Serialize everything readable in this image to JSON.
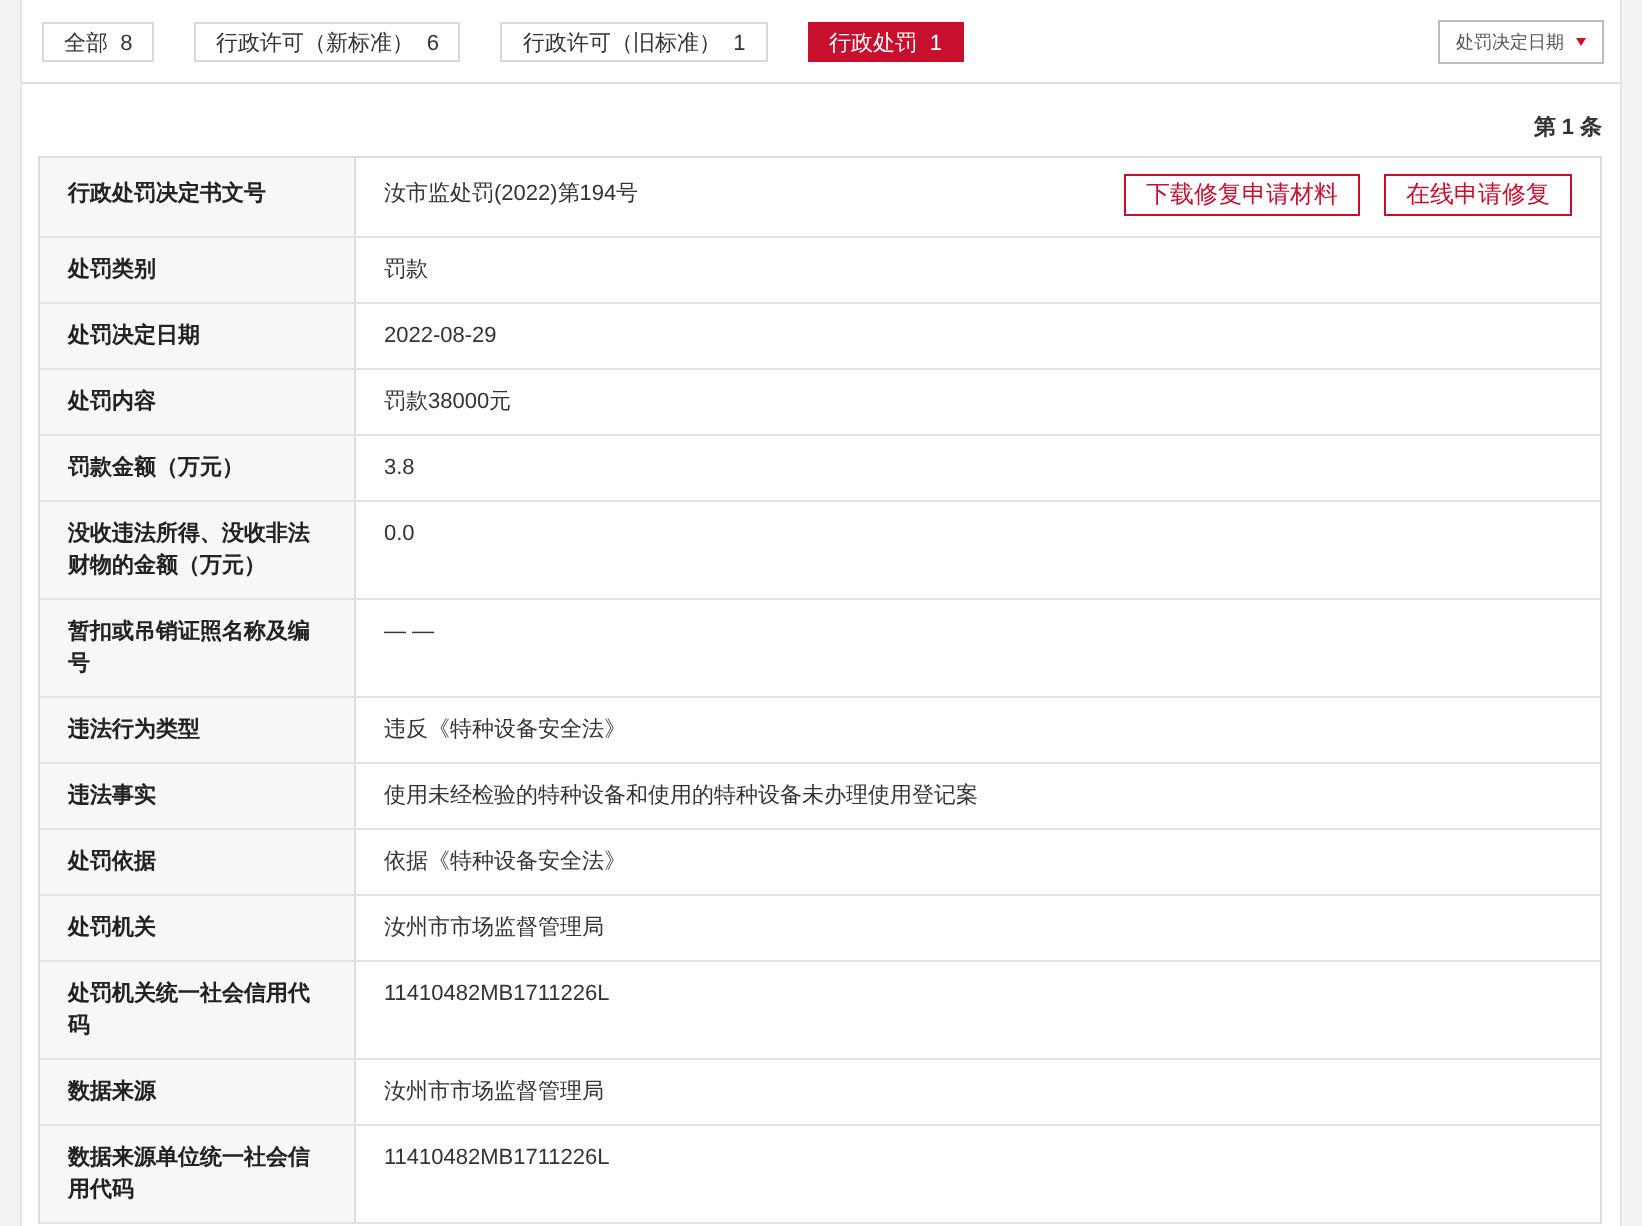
{
  "tabs": [
    {
      "label": "全部",
      "count": "8",
      "selected": false
    },
    {
      "label": "行政许可（新标准）",
      "count": "6",
      "selected": false
    },
    {
      "label": "行政许可（旧标准）",
      "count": "1",
      "selected": false
    },
    {
      "label": "行政处罚",
      "count": "1",
      "selected": true
    }
  ],
  "sort_button": {
    "label": "处罚决定日期"
  },
  "record_counter": "第 1 条",
  "actions": [
    "下载修复申请材料",
    "在线申请修复"
  ],
  "rows": [
    {
      "label": "行政处罚决定书文号",
      "value": "汝市监处罚(2022)第194号"
    },
    {
      "label": "处罚类别",
      "value": "罚款"
    },
    {
      "label": "处罚决定日期",
      "value": "2022-08-29"
    },
    {
      "label": "处罚内容",
      "value": "罚款38000元"
    },
    {
      "label": "罚款金额（万元）",
      "value": "3.8"
    },
    {
      "label": "没收违法所得、没收非法财物的金额（万元）",
      "value": "0.0"
    },
    {
      "label": "暂扣或吊销证照名称及编号",
      "value": "— —"
    },
    {
      "label": "违法行为类型",
      "value": "违反《特种设备安全法》"
    },
    {
      "label": "违法事实",
      "value": "使用未经检验的特种设备和使用的特种设备未办理使用登记案"
    },
    {
      "label": "处罚依据",
      "value": "依据《特种设备安全法》"
    },
    {
      "label": "处罚机关",
      "value": "汝州市市场监督管理局"
    },
    {
      "label": "处罚机关统一社会信用代码",
      "value": "11410482MB1711226L"
    },
    {
      "label": "数据来源",
      "value": "汝州市市场监督管理局"
    },
    {
      "label": "数据来源单位统一社会信用代码",
      "value": "11410482MB1711226L"
    }
  ]
}
